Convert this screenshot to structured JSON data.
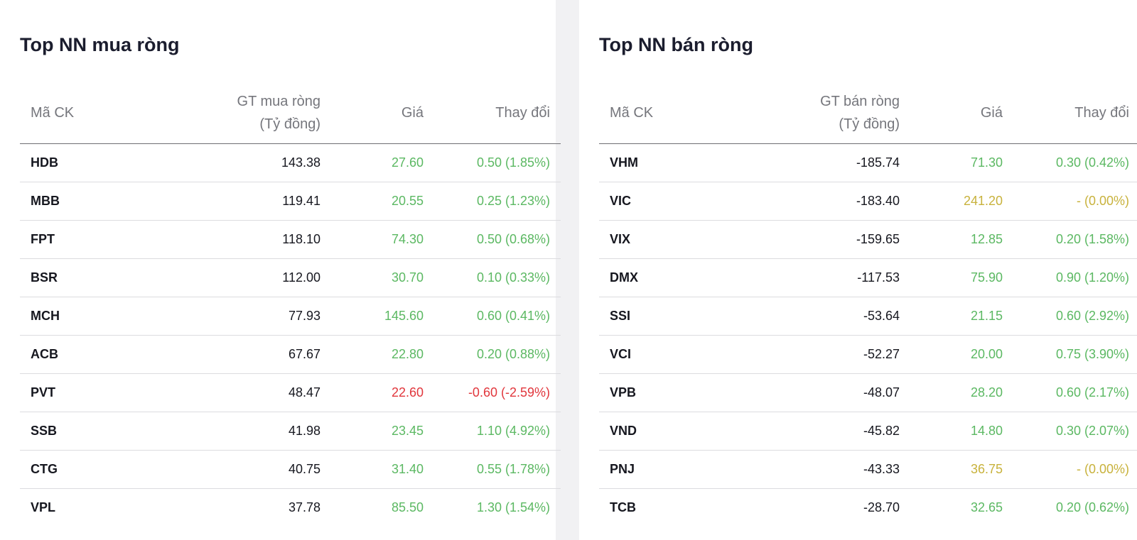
{
  "colors": {
    "up": "#5bb862",
    "ref": "#c8b23c",
    "down": "#e1363c"
  },
  "buy_panel": {
    "title": "Top NN mua ròng",
    "headers": {
      "code": "Mã CK",
      "value_line1": "GT mua ròng",
      "value_line2": "(Tỷ đồng)",
      "price": "Giá",
      "change": "Thay đổi"
    },
    "rows": [
      {
        "code": "HDB",
        "value": "143.38",
        "price": "27.60",
        "change": "0.50 (1.85%)",
        "trend": "up"
      },
      {
        "code": "MBB",
        "value": "119.41",
        "price": "20.55",
        "change": "0.25 (1.23%)",
        "trend": "up"
      },
      {
        "code": "FPT",
        "value": "118.10",
        "price": "74.30",
        "change": "0.50 (0.68%)",
        "trend": "up"
      },
      {
        "code": "BSR",
        "value": "112.00",
        "price": "30.70",
        "change": "0.10 (0.33%)",
        "trend": "up"
      },
      {
        "code": "MCH",
        "value": "77.93",
        "price": "145.60",
        "change": "0.60 (0.41%)",
        "trend": "up"
      },
      {
        "code": "ACB",
        "value": "67.67",
        "price": "22.80",
        "change": "0.20 (0.88%)",
        "trend": "up"
      },
      {
        "code": "PVT",
        "value": "48.47",
        "price": "22.60",
        "change": "-0.60 (-2.59%)",
        "trend": "down"
      },
      {
        "code": "SSB",
        "value": "41.98",
        "price": "23.45",
        "change": "1.10 (4.92%)",
        "trend": "up"
      },
      {
        "code": "CTG",
        "value": "40.75",
        "price": "31.40",
        "change": "0.55 (1.78%)",
        "trend": "up"
      },
      {
        "code": "VPL",
        "value": "37.78",
        "price": "85.50",
        "change": "1.30 (1.54%)",
        "trend": "up"
      }
    ]
  },
  "sell_panel": {
    "title": "Top NN bán ròng",
    "headers": {
      "code": "Mã CK",
      "value_line1": "GT bán ròng",
      "value_line2": "(Tỷ đồng)",
      "price": "Giá",
      "change": "Thay đổi"
    },
    "rows": [
      {
        "code": "VHM",
        "value": "-185.74",
        "price": "71.30",
        "change": "0.30 (0.42%)",
        "trend": "up"
      },
      {
        "code": "VIC",
        "value": "-183.40",
        "price": "241.20",
        "change": "- (0.00%)",
        "trend": "ref"
      },
      {
        "code": "VIX",
        "value": "-159.65",
        "price": "12.85",
        "change": "0.20 (1.58%)",
        "trend": "up"
      },
      {
        "code": "DMX",
        "value": "-117.53",
        "price": "75.90",
        "change": "0.90 (1.20%)",
        "trend": "up"
      },
      {
        "code": "SSI",
        "value": "-53.64",
        "price": "21.15",
        "change": "0.60 (2.92%)",
        "trend": "up"
      },
      {
        "code": "VCI",
        "value": "-52.27",
        "price": "20.00",
        "change": "0.75 (3.90%)",
        "trend": "up"
      },
      {
        "code": "VPB",
        "value": "-48.07",
        "price": "28.20",
        "change": "0.60 (2.17%)",
        "trend": "up"
      },
      {
        "code": "VND",
        "value": "-45.82",
        "price": "14.80",
        "change": "0.30 (2.07%)",
        "trend": "up"
      },
      {
        "code": "PNJ",
        "value": "-43.33",
        "price": "36.75",
        "change": "- (0.00%)",
        "trend": "ref"
      },
      {
        "code": "TCB",
        "value": "-28.70",
        "price": "32.65",
        "change": "0.20 (0.62%)",
        "trend": "up"
      }
    ]
  }
}
